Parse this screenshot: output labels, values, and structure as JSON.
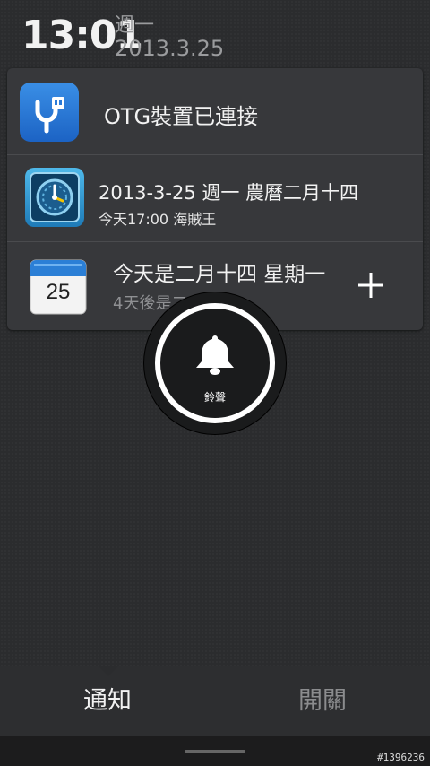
{
  "status": {
    "time": "13:01",
    "weekday": "週一",
    "date": "2013.3.25"
  },
  "notifications": [
    {
      "icon": "usb-otg-icon",
      "title": "OTG裝置已連接"
    },
    {
      "icon": "clock-icon",
      "title": "2013-3-25 週一 農曆二月十四",
      "subtitle": "今天17:00 海賊王"
    },
    {
      "icon": "calendar-icon",
      "icon_text": "25",
      "title": "今天是二月十四 星期一",
      "subtitle": "4天後是二十八"
    }
  ],
  "ring_toggle": {
    "label": "鈴聲",
    "icon": "bell-icon"
  },
  "tabs": [
    {
      "label": "通知",
      "active": true
    },
    {
      "label": "開關",
      "active": false
    }
  ],
  "watermark": "#1396236",
  "colors": {
    "accent_blue": "#2a7ad8",
    "background": "#2b2c2e"
  }
}
